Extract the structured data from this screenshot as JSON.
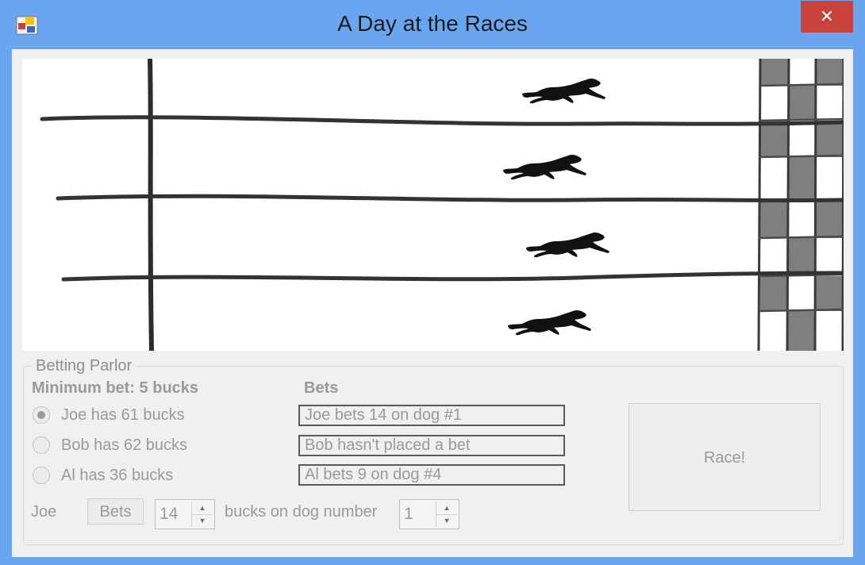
{
  "window": {
    "title": "A Day at the Races",
    "close_label": "✕"
  },
  "betting_parlor": {
    "legend": "Betting Parlor",
    "minimum_bet": "Minimum bet: 5 bucks",
    "bets_header": "Bets",
    "bettors": [
      {
        "label": "Joe has 61 bucks",
        "selected": true,
        "bet": "Joe bets 14 on dog #1"
      },
      {
        "label": "Bob has 62 bucks",
        "selected": false,
        "bet": "Bob hasn't placed a bet"
      },
      {
        "label": "Al has 36 bucks",
        "selected": false,
        "bet": "Al bets 9 on dog #4"
      }
    ],
    "bettor_name": "Joe",
    "bets_button": "Bets",
    "amount": "14",
    "dog_label": "bucks on dog number",
    "dog_number": "1",
    "race_button": "Race!"
  },
  "racetrack": {
    "dogs": [
      "dog-1",
      "dog-2",
      "dog-3",
      "dog-4"
    ]
  }
}
